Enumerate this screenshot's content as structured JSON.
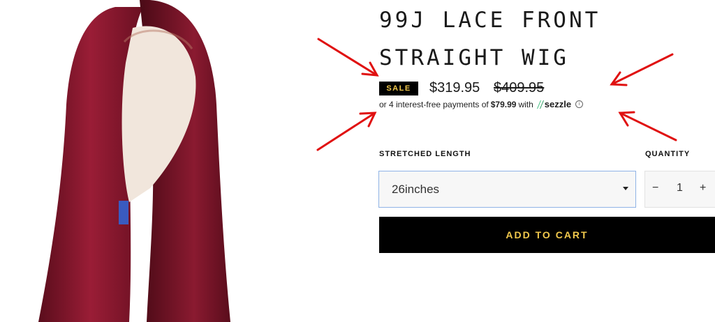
{
  "product": {
    "title": "99J LACE FRONT STRAIGHT WIG",
    "sale_badge": "SALE",
    "price": "$319.95",
    "compare_price": "$409.95"
  },
  "installments": {
    "prefix": "or 4 interest-free payments of",
    "amount": "$79.99",
    "suffix": "with",
    "provider": "sezzle",
    "info_icon": "info-icon",
    "logo_icon": "sezzle-leaf-icon"
  },
  "variant": {
    "label": "STRETCHED LENGTH",
    "selected": "26inches"
  },
  "quantity": {
    "label": "QUANTITY",
    "value": "1",
    "minus": "−",
    "plus": "+"
  },
  "add_to_cart": {
    "label": "ADD TO CART"
  },
  "colors": {
    "accent_gold": "#f2c94c",
    "button_black": "#000000",
    "select_border": "#8fb3e6",
    "annotation_red": "#e01010",
    "wig_burgundy": "#7d1128"
  }
}
